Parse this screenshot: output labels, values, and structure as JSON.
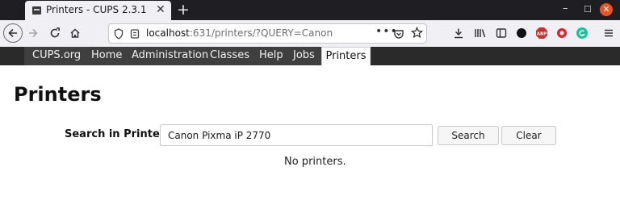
{
  "browser": {
    "tab_title": "Printers - CUPS 2.3.1",
    "url_host": "localhost",
    "url_rest": ":631/printers/?QUERY=Canon"
  },
  "icons": {
    "tab_favicon": "cups-printer-favicon",
    "back": "back-arrow-icon",
    "forward": "forward-arrow-icon",
    "reload": "reload-icon",
    "home": "home-icon",
    "downloads": "download-icon",
    "library": "library-icon",
    "sidebar": "sidebar-icon",
    "extension_1": "dark-circle-extension-icon",
    "adblock": "adblock-plus-icon",
    "extension_2": "red-extension-icon",
    "grammarly": "grammarly-icon",
    "menu": "hamburger-menu-icon"
  },
  "cups_menu": {
    "items": [
      {
        "label": "CUPS.org"
      },
      {
        "label": "Home"
      },
      {
        "label": "Administration"
      },
      {
        "label": "Classes"
      },
      {
        "label": "Help"
      },
      {
        "label": "Jobs"
      },
      {
        "label": "Printers",
        "active": true
      }
    ]
  },
  "page": {
    "title": "Printers",
    "search_label": "Search in Printers:",
    "search_value": "Canon Pixma iP 2770",
    "search_button": "Search",
    "clear_button": "Clear",
    "status": "No printers."
  },
  "colors": {
    "menubar": "#3f3f3f",
    "tabstrip": "#1f1e23",
    "window_close": "#e95420"
  }
}
